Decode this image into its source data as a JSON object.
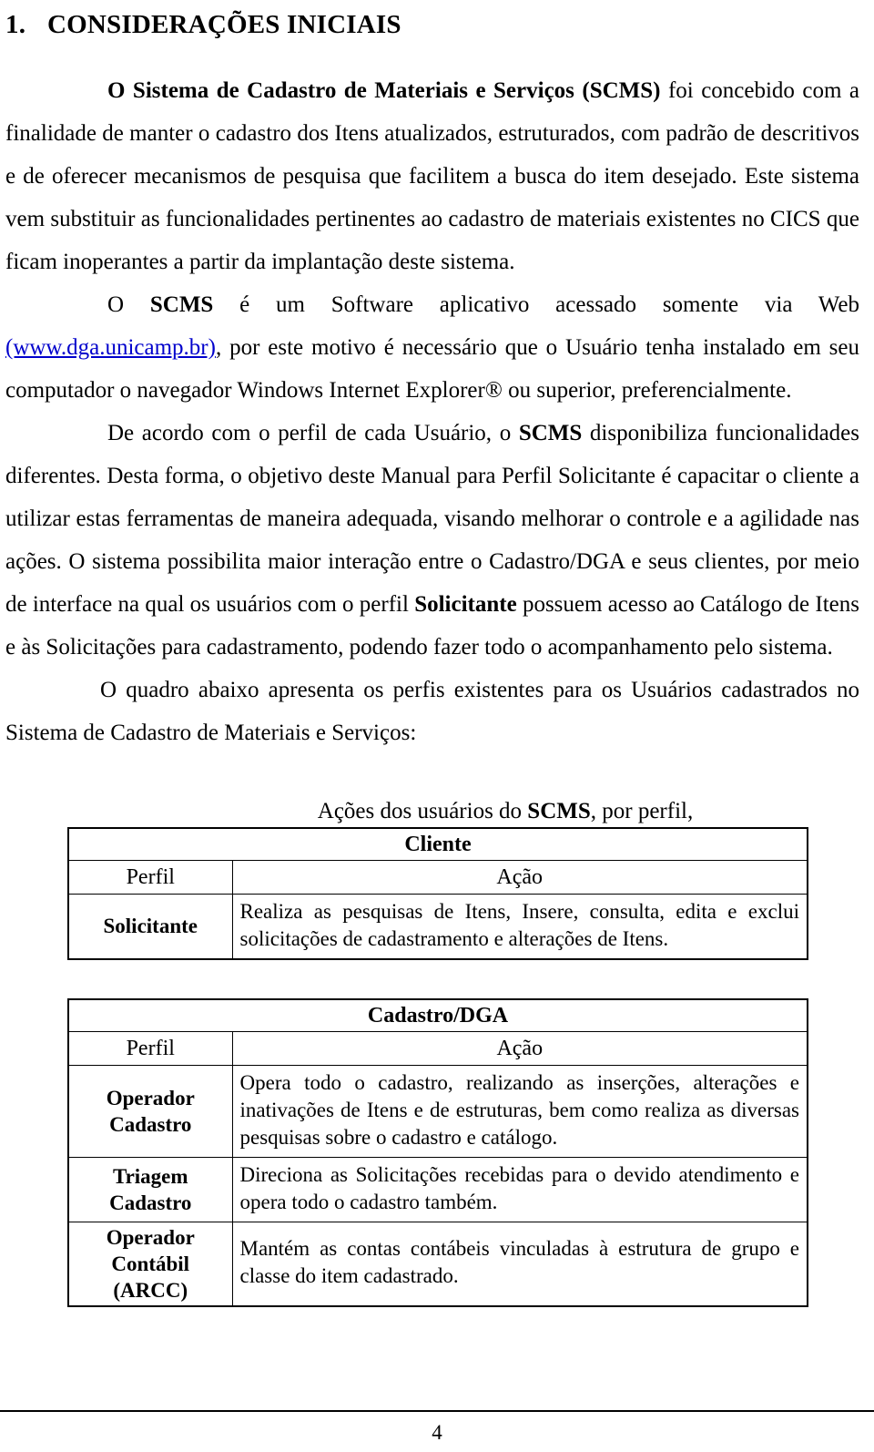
{
  "document": {
    "heading_number": "1.",
    "heading_text": "CONSIDERAÇÕES INICIAIS",
    "page_number": "4"
  },
  "paragraphs": {
    "p1": {
      "bold_lead": "O Sistema de Cadastro de Materiais e Serviços (SCMS)",
      "rest": " foi concebido com a finalidade de manter o cadastro dos Itens atualizados, estruturados, com padrão de descritivos e de oferecer mecanismos de pesquisa que facilitem a busca do item desejado.  Este sistema vem substituir as funcionalidades pertinentes ao cadastro de materiais existentes no CICS que ficam inoperantes a partir da implantação deste sistema."
    },
    "p2": {
      "lead": "O ",
      "bold_acronym": "SCMS",
      "mid": " é um Software aplicativo acessado somente via Web ",
      "link_text": "(www.dga.unicamp.br)",
      "rest": ", por este motivo é necessário que o Usuário tenha instalado em seu computador o navegador Windows Internet Explorer® ou superior, preferencialmente."
    },
    "p3": {
      "lead": "De acordo com o perfil de cada Usuário, o ",
      "bold_acronym": "SCMS",
      "mid": " disponibiliza funcionalidades diferentes. Desta forma, o objetivo deste Manual para Perfil Solicitante é capacitar o cliente a utilizar estas ferramentas de maneira adequada, visando melhorar o controle e a agilidade nas ações.  O sistema possibilita maior interação entre o Cadastro/DGA e seus clientes, por meio de interface na qual os usuários com o perfil ",
      "bold_term": "Solicitante",
      "rest": " possuem acesso ao Catálogo de Itens e às Solicitações para cadastramento, podendo fazer todo o acompanhamento pelo sistema."
    },
    "p4": {
      "text": "O quadro abaixo apresenta os perfis existentes para os Usuários cadastrados no Sistema de Cadastro de Materiais e Serviços:"
    }
  },
  "caption": {
    "prefix": "Ações dos usuários do ",
    "bold_acronym": "SCMS",
    "suffix": ", por perfil,"
  },
  "tables": [
    {
      "group_header": "Cliente",
      "columns": [
        "Perfil",
        "Ação"
      ],
      "rows": [
        {
          "profile": "Solicitante",
          "action": "Realiza as pesquisas de Itens, Insere, consulta, edita e exclui solicitações de cadastramento e alterações de Itens."
        }
      ]
    },
    {
      "group_header": "Cadastro/DGA",
      "columns": [
        "Perfil",
        "Ação"
      ],
      "rows": [
        {
          "profile": "Operador Cadastro",
          "profile_line1": "Operador",
          "profile_line2": "Cadastro",
          "action": "Opera todo o cadastro, realizando as inserções, alterações e inativações de Itens e de estruturas, bem como realiza as diversas pesquisas sobre o cadastro e catálogo."
        },
        {
          "profile": "Triagem Cadastro",
          "profile_line1": "Triagem",
          "profile_line2": "Cadastro",
          "action": "Direciona as Solicitações recebidas para o devido atendimento e opera todo o cadastro também."
        },
        {
          "profile": "Operador Contábil (ARCC)",
          "profile_line1": "Operador",
          "profile_line2": "Contábil",
          "profile_line3": "(ARCC)",
          "action": "Mantém as contas contábeis vinculadas à estrutura de grupo e classe do item cadastrado."
        }
      ]
    }
  ]
}
